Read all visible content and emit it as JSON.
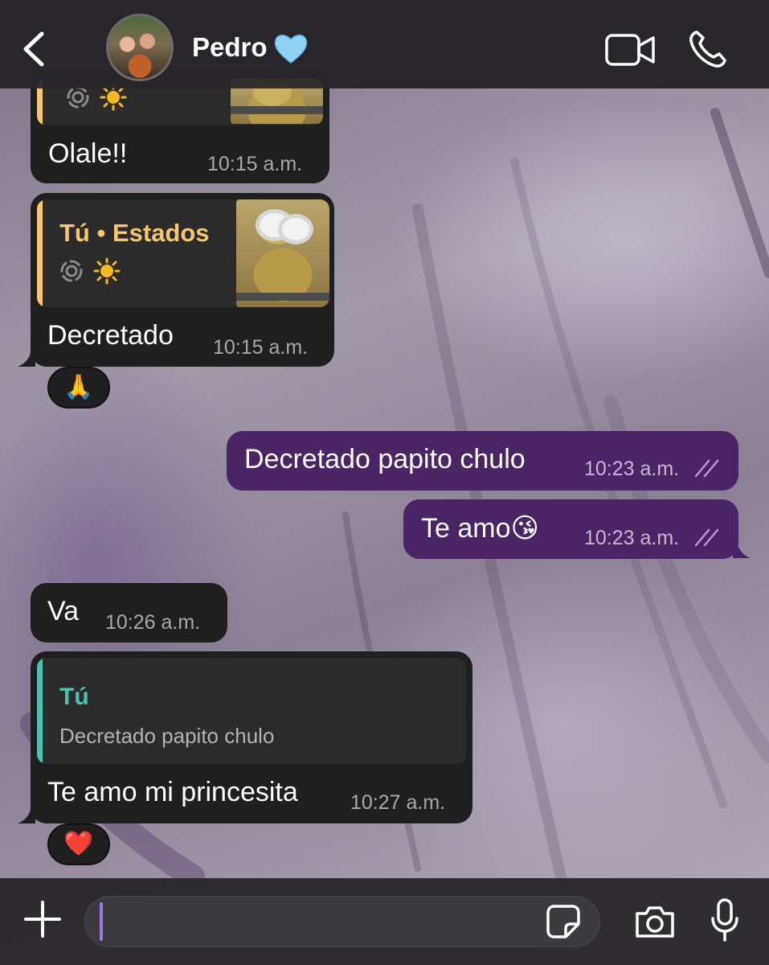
{
  "header": {
    "contact_name": "Pedro",
    "contact_emoji": "blue-heart"
  },
  "messages": [
    {
      "id": "m1",
      "direction": "incoming",
      "text": "Olale!!",
      "time": "10:15 a.m.",
      "quote": {
        "image": "minion-thumbnail",
        "icons": [
          "status-ring-icon",
          "sun-icon"
        ]
      }
    },
    {
      "id": "m2",
      "direction": "incoming",
      "text": "Decretado",
      "time": "10:15 a.m.",
      "quote": {
        "title": "Tú • Estados",
        "image": "minion-thumbnail",
        "icons": [
          "status-ring-icon",
          "sun-icon"
        ]
      },
      "reaction": "🙏"
    },
    {
      "id": "m3",
      "direction": "outgoing",
      "text": "Decretado papito chulo",
      "time": "10:23 a.m.",
      "status": "read"
    },
    {
      "id": "m4",
      "direction": "outgoing",
      "text": "Te amo😘",
      "time": "10:23 a.m.",
      "status": "read"
    },
    {
      "id": "m5",
      "direction": "incoming",
      "text": "Va",
      "time": "10:26 a.m."
    },
    {
      "id": "m6",
      "direction": "incoming",
      "text": "Te amo mi princesita",
      "time": "10:27 a.m.",
      "quote": {
        "title": "Tú",
        "text": "Decretado papito chulo"
      },
      "reaction": "❤️"
    }
  ],
  "composer": {
    "value": ""
  },
  "colors": {
    "header_bg": "#28262a",
    "incoming_bubble": "#1f1f1f",
    "outgoing_bubble": "#4a2565",
    "status_quote_accent": "#f5c86b",
    "reply_quote_accent": "#4fc1b0",
    "read_ticks": "#b894e8",
    "caret": "#a578d6"
  }
}
